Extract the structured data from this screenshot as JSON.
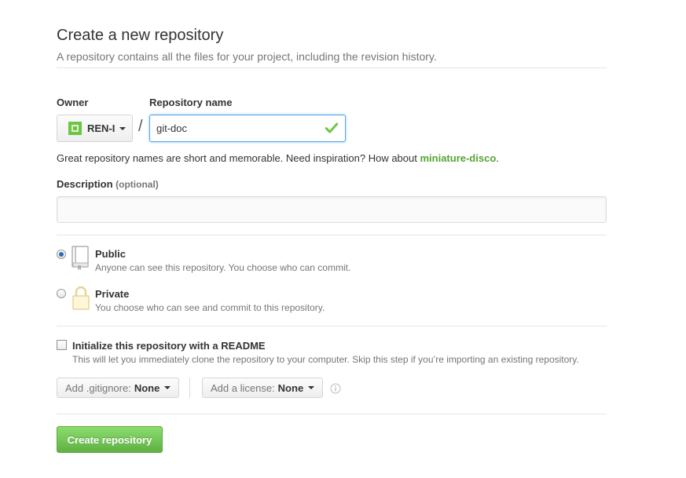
{
  "header": {
    "title": "Create a new repository",
    "subtitle": "A repository contains all the files for your project, including the revision history."
  },
  "owner": {
    "label": "Owner",
    "selected": "REN-I",
    "separator": "/"
  },
  "repo_name": {
    "label": "Repository name",
    "value": "git-doc"
  },
  "hint": {
    "text": "Great repository names are short and memorable. Need inspiration? How about ",
    "suggestion": "miniature-disco",
    "suffix": "."
  },
  "description": {
    "label": "Description",
    "optional": "(optional)",
    "value": ""
  },
  "visibility": {
    "public": {
      "title": "Public",
      "desc": "Anyone can see this repository. You choose who can commit.",
      "checked": true
    },
    "private": {
      "title": "Private",
      "desc": "You choose who can see and commit to this repository.",
      "checked": false
    }
  },
  "readme": {
    "title": "Initialize this repository with a README",
    "desc": "This will let you immediately clone the repository to your computer. Skip this step if you’re importing an existing repository.",
    "checked": false
  },
  "gitignore": {
    "label": "Add .gitignore:",
    "value": "None"
  },
  "license": {
    "label": "Add a license:",
    "value": "None"
  },
  "submit": {
    "label": "Create repository"
  },
  "colors": {
    "accent_green": "#55a532",
    "button_green": "#60b044",
    "focus_blue": "#51a7e8",
    "muted_text": "#767676"
  },
  "icons": {
    "check": "check-icon",
    "public_repo": "repo-book-icon",
    "private_repo": "lock-icon",
    "info": "info-icon"
  }
}
